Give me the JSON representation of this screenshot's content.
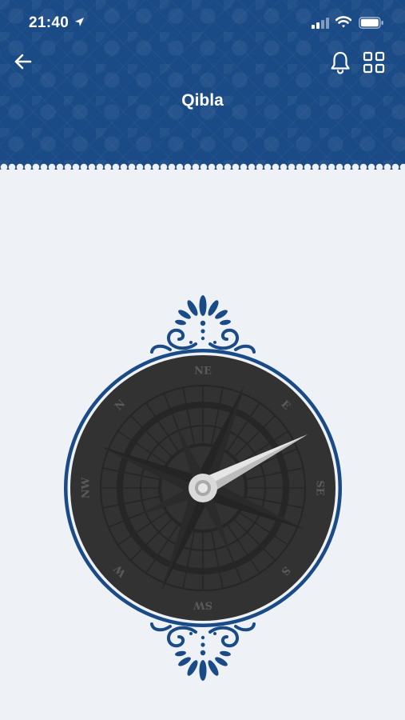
{
  "status_bar": {
    "time": "21:40"
  },
  "header": {
    "title": "Qibla"
  },
  "icons": {
    "back": "back-arrow-icon",
    "location": "location-arrow-icon",
    "notification": "bell-icon",
    "menu": "grid-icon"
  },
  "compass": {
    "directions": [
      "N",
      "NE",
      "E",
      "SE",
      "S",
      "SW",
      "W",
      "NW"
    ]
  },
  "colors": {
    "header_blue": "#1b4b86",
    "ornament_blue": "#1b4b86",
    "dial_dark": "#323232",
    "background": "#eef2f7"
  }
}
